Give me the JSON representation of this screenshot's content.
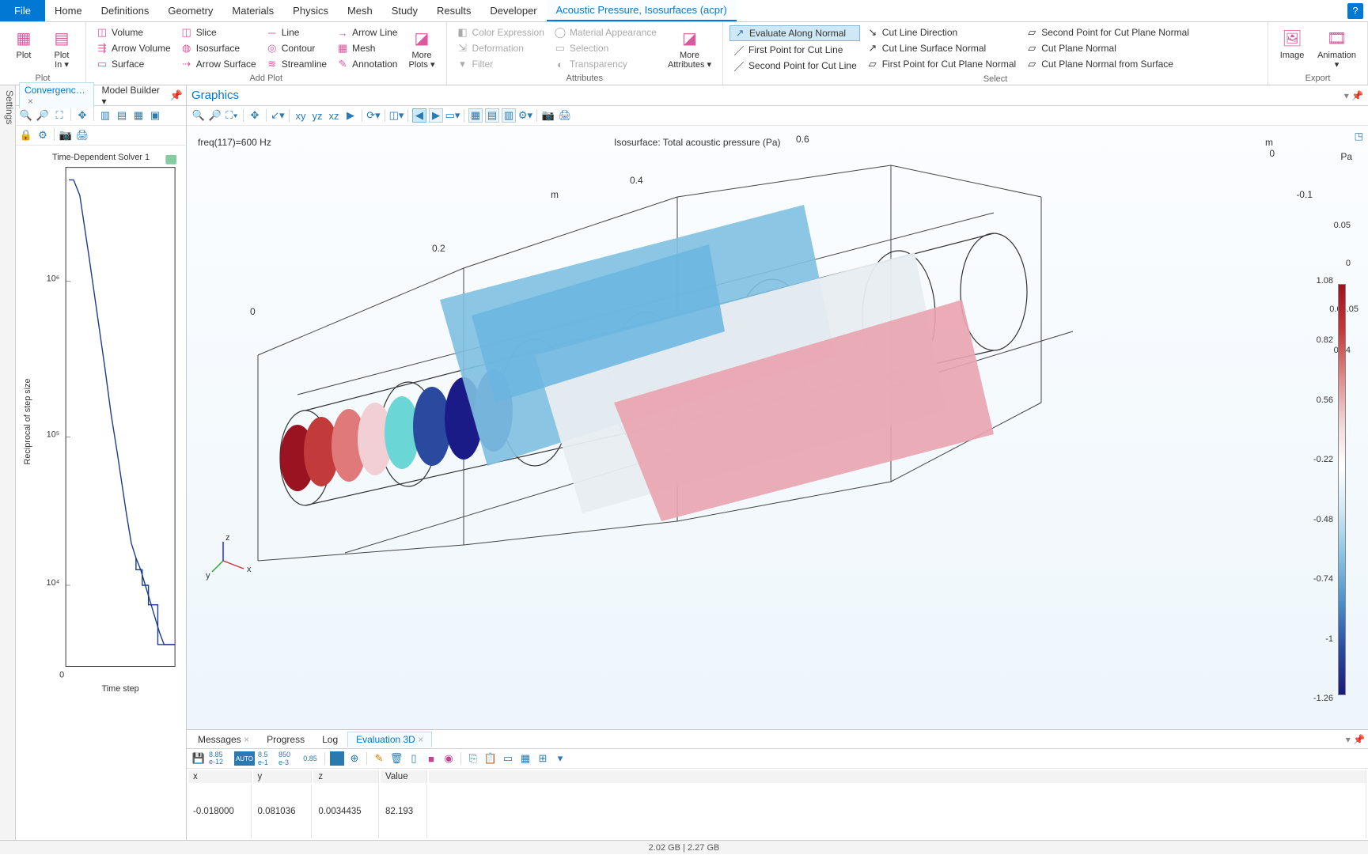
{
  "menubar": {
    "file": "File",
    "tabs": [
      "Home",
      "Definitions",
      "Geometry",
      "Materials",
      "Physics",
      "Mesh",
      "Study",
      "Results",
      "Developer"
    ],
    "active_tab": "Acoustic Pressure, Isosurfaces (acpr)",
    "help": "?"
  },
  "ribbon": {
    "plot": {
      "label": "Plot",
      "plot_btn": "Plot",
      "plot_in_btn": "Plot\nIn ▾"
    },
    "add_plot": {
      "label": "Add Plot",
      "col1": [
        "Volume",
        "Arrow Volume",
        "Surface"
      ],
      "col2": [
        "Slice",
        "Isosurface",
        "Arrow Surface"
      ],
      "col3": [
        "Line",
        "Contour",
        "Streamline"
      ],
      "col4": [
        "Arrow Line",
        "Mesh",
        "Annotation"
      ],
      "more": "More\nPlots ▾"
    },
    "attributes": {
      "label": "Attributes",
      "col1": [
        "Color Expression",
        "Deformation",
        "Filter"
      ],
      "col2": [
        "Material Appearance",
        "Selection",
        "Transparency"
      ],
      "more": "More\nAttributes ▾"
    },
    "select": {
      "label": "Select",
      "col1": [
        "Evaluate Along Normal",
        "First Point for Cut Line",
        "Second Point for Cut Line"
      ],
      "col2": [
        "Cut Line Direction",
        "Cut Line Surface Normal",
        "First Point for Cut Plane Normal"
      ],
      "col3": [
        "Second Point for Cut Plane Normal",
        "Cut Plane Normal",
        "Cut Plane Normal from Surface"
      ]
    },
    "export": {
      "label": "Export",
      "image": "Image",
      "animation": "Animation\n▾"
    }
  },
  "settings_rail": "Settings",
  "left_panel": {
    "tabs": {
      "convergence": "Convergenc…",
      "model_builder": "Model Builder  ▾"
    },
    "plot_title": "Time-Dependent Solver 1",
    "ylabel": "Reciprocal of step size",
    "xlabel": "Time step",
    "yticks": [
      "10⁶",
      "10⁵",
      "10⁴"
    ],
    "xzero": "0"
  },
  "graphics": {
    "title": "Graphics",
    "freq_label": "freq(117)=600 Hz",
    "iso_label": "Isosurface: Total acoustic pressure (Pa)",
    "axis_m": "m",
    "axis_pa": "Pa",
    "axis_ticks_top": [
      "0",
      "0.2",
      "0.4",
      "0.6"
    ],
    "axis_ticks_right": [
      "0",
      "-0.1"
    ],
    "extra_labels": [
      "0.05",
      "0",
      "0.03.05",
      "0.04"
    ],
    "colorbar_ticks": [
      "1.08",
      "0.82",
      "0.56",
      "-0.22",
      "-0.48",
      "-0.74",
      "-1",
      "-1.26"
    ],
    "triad": {
      "x": "x",
      "y": "y",
      "z": "z"
    }
  },
  "bottom": {
    "tabs": [
      "Messages",
      "Progress",
      "Log",
      "Evaluation 3D"
    ],
    "tool_labels": [
      "8.85 e-12",
      "AUTO",
      "8.5 e-1",
      "850 e-3",
      "0.85"
    ],
    "table": {
      "headers": [
        "x",
        "y",
        "z",
        "Value"
      ],
      "row": [
        "-0.018000",
        "0.081036",
        "0.0034435",
        "82.193"
      ]
    }
  },
  "statusbar": "2.02 GB | 2.27 GB",
  "chart_data": {
    "type": "line",
    "title": "Time-Dependent Solver 1",
    "ylabel": "Reciprocal of step size",
    "xlabel": "Time step",
    "yscale": "log",
    "ylim": [
      5000,
      3000000
    ],
    "x": [
      0,
      5,
      10,
      20,
      30,
      40,
      50,
      55,
      58,
      62,
      66,
      70,
      74,
      78,
      82,
      86,
      90,
      95,
      100
    ],
    "y": [
      2500000,
      2500000,
      2500000,
      1800000,
      900000,
      450000,
      220000,
      110000,
      70000,
      50000,
      40000,
      30000,
      20000,
      15000,
      12000,
      10000,
      9000,
      7500,
      7000
    ]
  }
}
